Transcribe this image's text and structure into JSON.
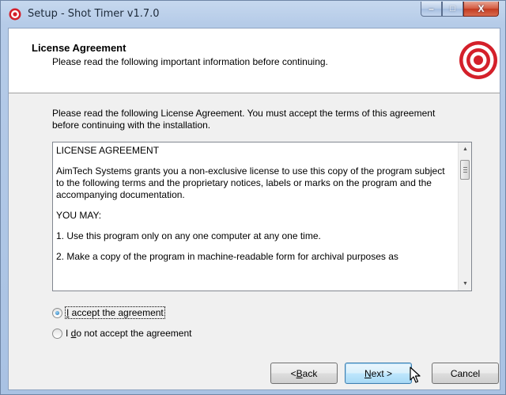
{
  "window": {
    "title": "Setup - Shot Timer v1.7.0",
    "controls": {
      "minimize": "–",
      "maximize": "□",
      "close": "X"
    }
  },
  "header": {
    "title": "License Agreement",
    "subtitle": "Please read the following important information before continuing.",
    "logo_icon": "target-icon",
    "logo_color": "#d4202a"
  },
  "intro": "Please read the following License Agreement. You must accept the terms of this agreement before continuing with the installation.",
  "license": {
    "paragraphs": [
      "LICENSE AGREEMENT",
      "AimTech Systems grants you a non-exclusive license to use this copy of the program subject to the following terms and the proprietary notices, labels or marks on the program and the accompanying documentation.",
      "YOU MAY:",
      "1. Use this program only on any one computer at any one time.",
      "2. Make a copy of the program in machine-readable form for archival purposes as"
    ]
  },
  "options": {
    "accept": {
      "prefix": "",
      "hotkey": "I",
      "rest": " accept the agreement",
      "checked": true
    },
    "decline": {
      "prefix": "I ",
      "hotkey": "d",
      "rest": "o not accept the agreement",
      "checked": false
    }
  },
  "buttons": {
    "back": {
      "prefix": "< ",
      "hotkey": "B",
      "rest": "ack"
    },
    "next": {
      "prefix": "",
      "hotkey": "N",
      "rest": "ext >"
    },
    "cancel": {
      "label": "Cancel"
    }
  }
}
